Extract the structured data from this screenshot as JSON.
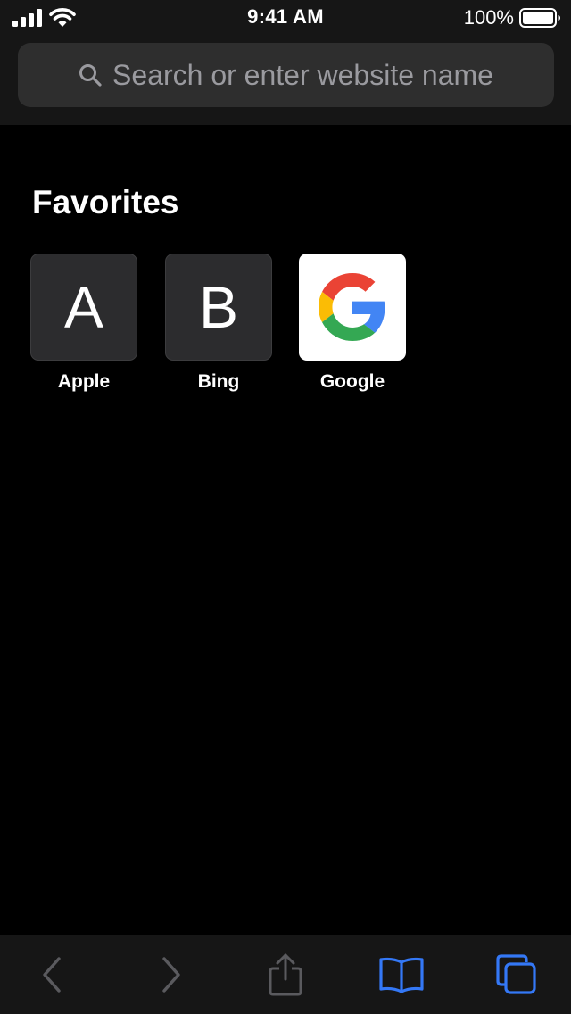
{
  "status_bar": {
    "time": "9:41 AM",
    "battery_percent": "100%",
    "icons": [
      "cellular-signal-icon",
      "wifi-icon",
      "battery-icon"
    ]
  },
  "search": {
    "placeholder": "Search or enter website name",
    "icon": "search-icon"
  },
  "favorites": {
    "heading": "Favorites",
    "items": [
      {
        "letter": "A",
        "label": "Apple"
      },
      {
        "letter": "B",
        "label": "Bing"
      },
      {
        "letter": "",
        "label": "Google",
        "icon": "google-logo"
      }
    ]
  },
  "toolbar": {
    "items": [
      {
        "icon": "back-arrow-icon",
        "enabled": false
      },
      {
        "icon": "forward-arrow-icon",
        "enabled": false
      },
      {
        "icon": "share-icon",
        "enabled": false
      },
      {
        "icon": "bookmarks-icon",
        "enabled": true
      },
      {
        "icon": "tabs-icon",
        "enabled": true
      }
    ]
  },
  "colors": {
    "accent": "#3478f6",
    "disabled": "#5a5a5e",
    "chrome_background": "#161616",
    "page_background": "#000000",
    "search_field": "#2e2e2e",
    "placeholder_text": "#9a9a9f"
  }
}
